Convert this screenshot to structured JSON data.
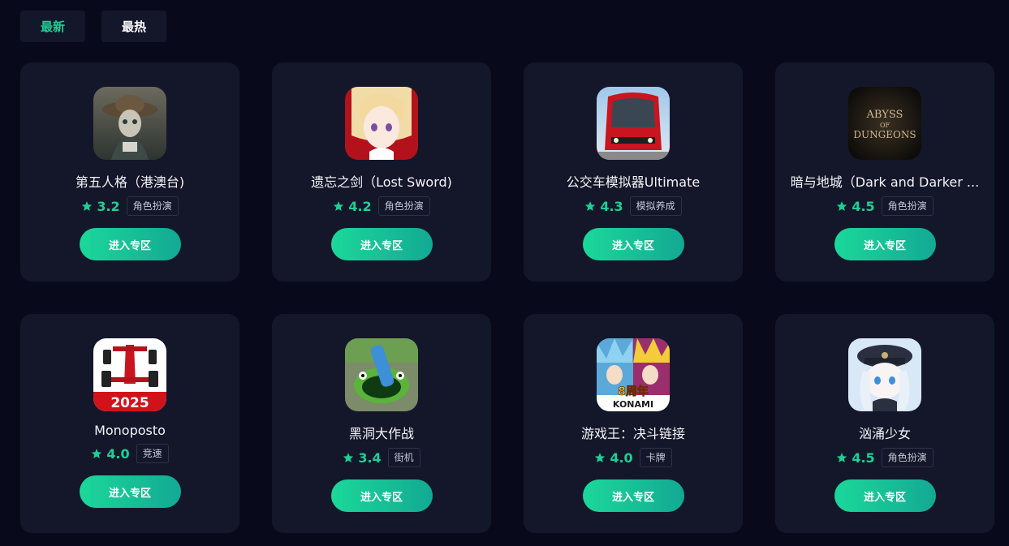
{
  "tabs": [
    {
      "label": "最新",
      "active": true
    },
    {
      "label": "最热",
      "active": false
    }
  ],
  "accent_color": "#1ecf94",
  "games": [
    {
      "name": "第五人格（港澳台)",
      "rating": "3.2",
      "tag": "角色扮演",
      "button": "进入专区",
      "icon": "identity-v-icon"
    },
    {
      "name": "遗忘之剑（Lost Sword)",
      "rating": "4.2",
      "tag": "角色扮演",
      "button": "进入专区",
      "icon": "lost-sword-icon"
    },
    {
      "name": "公交车模拟器Ultimate",
      "rating": "4.3",
      "tag": "模拟养成",
      "button": "进入专区",
      "icon": "bus-simulator-icon"
    },
    {
      "name": "暗与地城（Dark and Darker ...",
      "rating": "4.5",
      "tag": "角色扮演",
      "button": "进入专区",
      "icon": "abyss-of-dungeons-icon"
    },
    {
      "name": "Monoposto",
      "rating": "4.0",
      "tag": "竞速",
      "button": "进入专区",
      "icon": "monoposto-icon"
    },
    {
      "name": "黑洞大作战",
      "rating": "3.4",
      "tag": "街机",
      "button": "进入专区",
      "icon": "hole-io-icon"
    },
    {
      "name": "游戏王：决斗链接",
      "rating": "4.0",
      "tag": "卡牌",
      "button": "进入专区",
      "icon": "yugioh-duel-links-icon"
    },
    {
      "name": "汹涌少女",
      "rating": "4.5",
      "tag": "角色扮演",
      "button": "进入专区",
      "icon": "surging-girl-icon"
    }
  ],
  "icon_text": {
    "monoposto_year": "2025",
    "abyss_line1": "ABYSS",
    "abyss_line2": "OF",
    "abyss_line3": "DUNGEONS",
    "yugioh_badge": "8周年",
    "yugioh_brand": "KONAMI"
  }
}
